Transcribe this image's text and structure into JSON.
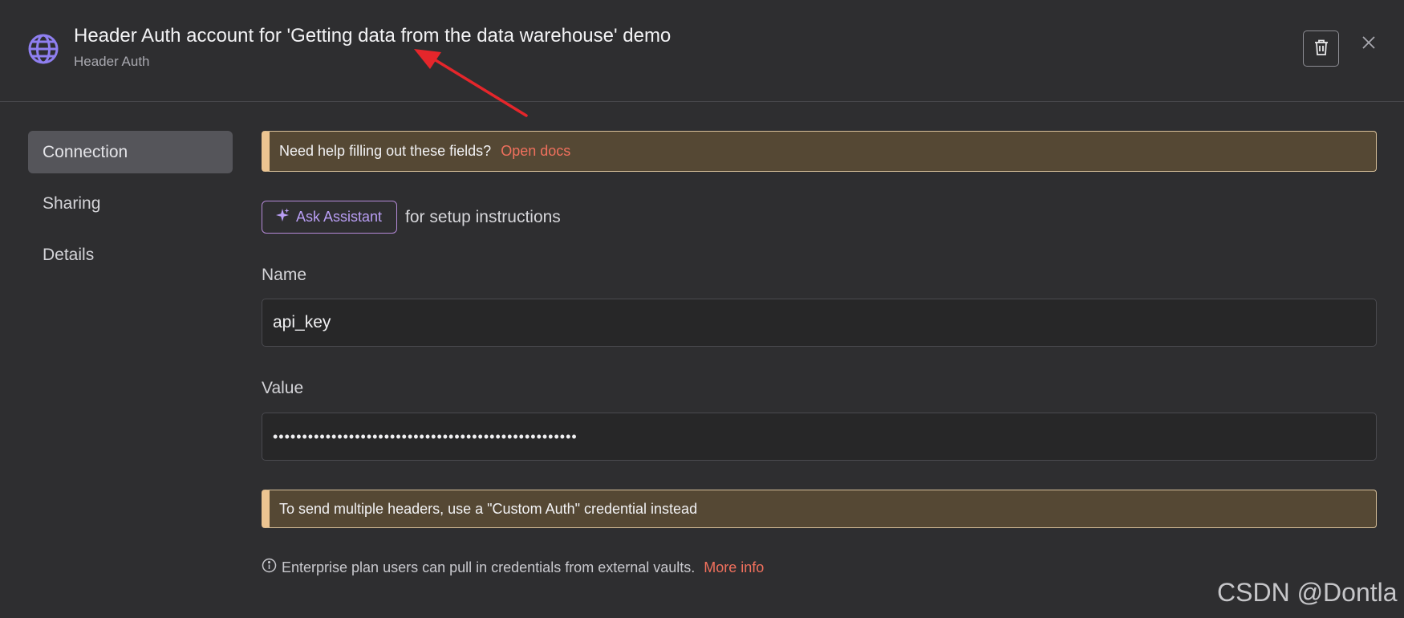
{
  "header": {
    "title": "Header Auth account for 'Getting data from the data warehouse' demo",
    "subtitle": "Header Auth",
    "icon": "globe-icon"
  },
  "sidebar": {
    "items": [
      {
        "label": "Connection",
        "active": true
      },
      {
        "label": "Sharing",
        "active": false
      },
      {
        "label": "Details",
        "active": false
      }
    ]
  },
  "main": {
    "help_callout": {
      "text": "Need help filling out these fields?",
      "link": "Open docs"
    },
    "assistant": {
      "button_label": "Ask Assistant",
      "suffix": "for setup instructions"
    },
    "name_field": {
      "label": "Name",
      "value": "api_key"
    },
    "value_field": {
      "label": "Value",
      "value": "••••••••••••••••••••••••••••••••••••••••••••••••••••"
    },
    "headers_callout": {
      "text": "To send multiple headers, use a \"Custom Auth\" credential instead"
    },
    "info": {
      "text": "Enterprise plan users can pull in credentials from external vaults.",
      "link": "More info"
    }
  },
  "watermark": "CSDN @Dontla",
  "colors": {
    "background": "#2e2e30",
    "accent_link": "#f0705d",
    "callout_bg": "#554834",
    "callout_border": "#ecc491",
    "assistant": "#b99ef4",
    "globe": "#8f7ff0",
    "annotation_arrow": "#e5262b"
  }
}
